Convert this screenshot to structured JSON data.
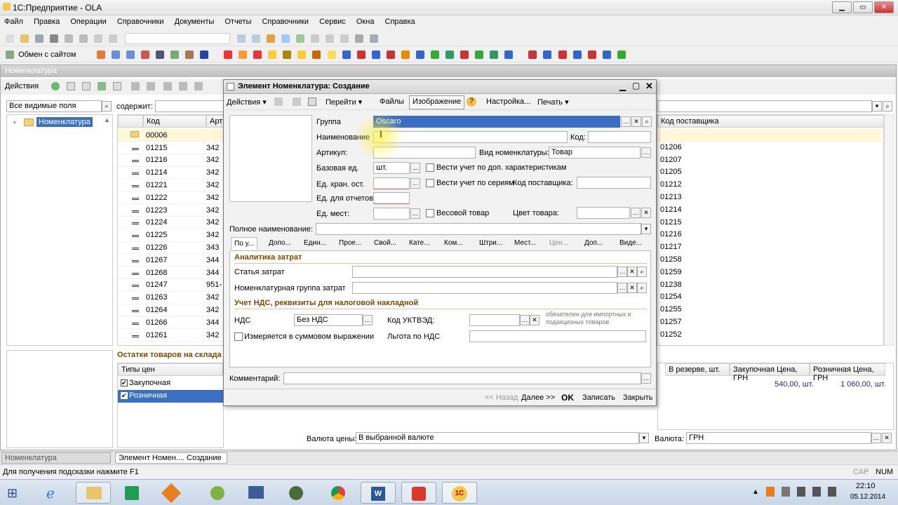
{
  "app": {
    "title": "1С:Предприятие - OLA"
  },
  "menu": [
    "Файл",
    "Правка",
    "Операции",
    "Справочники",
    "Документы",
    "Отчеты",
    "Справочники",
    "Сервис",
    "Окна",
    "Справка"
  ],
  "toolbar2": {
    "exchange_label": "Обмен с сайтом"
  },
  "bgwin": {
    "title": "Номенклатура",
    "actions_label": "Действия",
    "fields_select": "Все видимые поля",
    "contains_label": "содержит:",
    "tree_root": "Номенклатура",
    "col_code": "Код",
    "col_art": "Арти",
    "col_supplier_code": "Код поставщика",
    "rows": [
      {
        "code": "00006",
        "art": "",
        "sup": ""
      },
      {
        "code": "01215",
        "art": "342",
        "sup": "01206"
      },
      {
        "code": "01216",
        "art": "342",
        "sup": "01207"
      },
      {
        "code": "01214",
        "art": "342",
        "sup": "01205"
      },
      {
        "code": "01221",
        "art": "342",
        "sup": "01212"
      },
      {
        "code": "01222",
        "art": "342",
        "sup": "01213"
      },
      {
        "code": "01223",
        "art": "342",
        "sup": "01214"
      },
      {
        "code": "01224",
        "art": "342",
        "sup": "01215"
      },
      {
        "code": "01225",
        "art": "342",
        "sup": "01216"
      },
      {
        "code": "01226",
        "art": "343",
        "sup": "01217"
      },
      {
        "code": "01267",
        "art": "344",
        "sup": "01258"
      },
      {
        "code": "01268",
        "art": "344",
        "sup": "01259"
      },
      {
        "code": "01247",
        "art": "951-",
        "sup": "01238"
      },
      {
        "code": "01263",
        "art": "342",
        "sup": "01254"
      },
      {
        "code": "01264",
        "art": "342",
        "sup": "01255"
      },
      {
        "code": "01266",
        "art": "344",
        "sup": "01257"
      },
      {
        "code": "01261",
        "art": "342",
        "sup": "01252"
      }
    ],
    "stock_title": "Остатки товаров на склада",
    "price_types_header": "Типы цен",
    "price_types": [
      "Закупочная",
      "Розничная"
    ],
    "col_reserve": "В резерве, шт.",
    "col_purchase": "Закупочная Цена, ГРН",
    "col_retail": "Розничная Цена, ГРН",
    "purchase_value": "540,00, шт.",
    "retail_value": "1 060,00, шт.",
    "price_currency_label": "Валюта цены:",
    "price_currency_value": "В выбранной валюте",
    "currency_label": "Валюта:",
    "currency_value": "ГРН"
  },
  "dialog": {
    "title": "Элемент Номенклатура: Создание",
    "toolbar": {
      "actions": "Действия",
      "goto": "Перейти",
      "files": "Файлы",
      "image": "Изображение",
      "settings": "Настройка...",
      "print": "Печать"
    },
    "group_label": "Группа",
    "group_value": "Oscaro",
    "name_label": "Наименование",
    "code_label": "Код:",
    "article_label": "Артикул:",
    "nom_type_label": "Вид номенклатуры:",
    "nom_type_value": "Товар",
    "base_unit_label": "Базовая ед.",
    "base_unit_value": "шт.",
    "extra_chars_label": "Вести учет по доп. характеристикам",
    "storage_unit_label": "Ед. хран. ост.",
    "series_label": "Вести учет по сериям",
    "supplier_code_label": "Код поставщика:",
    "report_unit_label": "Ед. для отчетов:",
    "place_unit_label": "Ед. мест:",
    "weight_label": "Весовой товар",
    "color_label": "Цвет товара:",
    "fullname_label": "Полное наименование:",
    "tabs": [
      "По у...",
      "Допо...",
      "Един...",
      "Прое...",
      "Свой...",
      "Кате...",
      "Ком...",
      "Штри...",
      "Мест...",
      "Цен...",
      "Доп...",
      "Виде..."
    ],
    "sec_analytics": "Аналитика затрат",
    "cost_item_label": "Статья затрат",
    "nom_group_label": "Номенклатурная группа затрат",
    "sec_vat": "Учет НДС, реквизиты для налоговой накладной",
    "vat_label": "НДС",
    "vat_value": "Без НДС",
    "uktved_label": "Код УКТВЭД:",
    "uktved_note": "обязателен для импортных и подакцизных товаров",
    "sum_expr_label": "Измеряется в суммовом выражении",
    "vat_benefit_label": "Льгота по НДС",
    "comment_label": "Комментарий:",
    "footer": {
      "back": "<< Назад",
      "next": "Далее >>",
      "ok": "OK",
      "save": "Записать",
      "close": "Закрыть"
    }
  },
  "window_tabs": [
    "Номенклатура",
    "Элемент Номен.... Создание"
  ],
  "status": {
    "hint": "Для получения подсказки нажмите F1",
    "caps": "CAP",
    "num": "NUM"
  },
  "taskbar": {
    "time": "22:10",
    "date": "05.12.2014"
  }
}
